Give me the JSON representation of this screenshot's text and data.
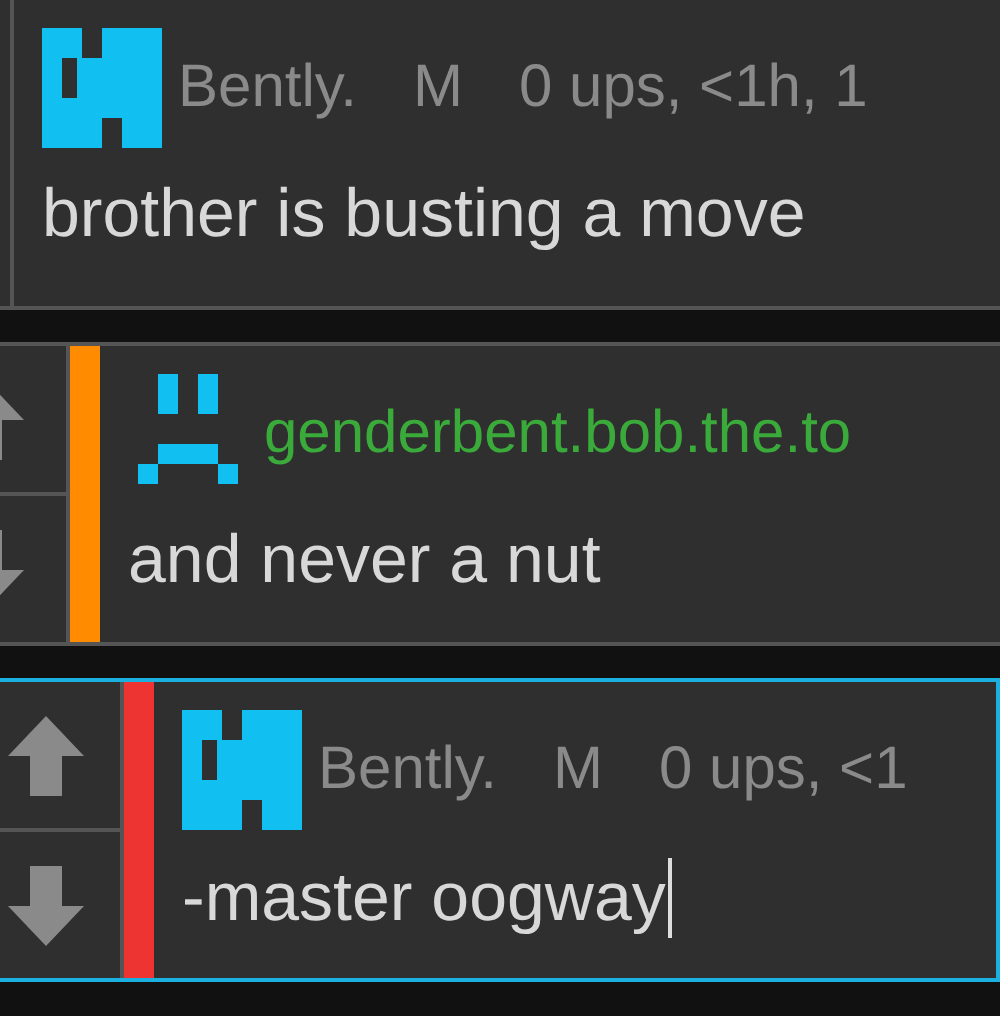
{
  "comments": [
    {
      "avatar": {
        "kind": "block"
      },
      "username": {
        "text": "Bently.",
        "color": "#8a8a8a"
      },
      "badge": "M",
      "meta": "0 ups, <1h, 1",
      "body": "brother is busting a move",
      "focused": false
    },
    {
      "votes": {
        "kind": "partial"
      },
      "accent": {
        "color": "#ff8c00"
      },
      "avatar": {
        "kind": "frown"
      },
      "username": {
        "text": "genderbent.bob.the.to",
        "color": "#3aaa3a"
      },
      "body": "and never a nut",
      "focused": false
    },
    {
      "votes": {
        "kind": "full"
      },
      "accent": {
        "color": "#ee3333"
      },
      "avatar": {
        "kind": "block"
      },
      "username": {
        "text": "Bently.",
        "color": "#8a8a8a"
      },
      "badge": "M",
      "meta": "0 ups, <1",
      "body": "-master oogway",
      "focused": true
    }
  ]
}
